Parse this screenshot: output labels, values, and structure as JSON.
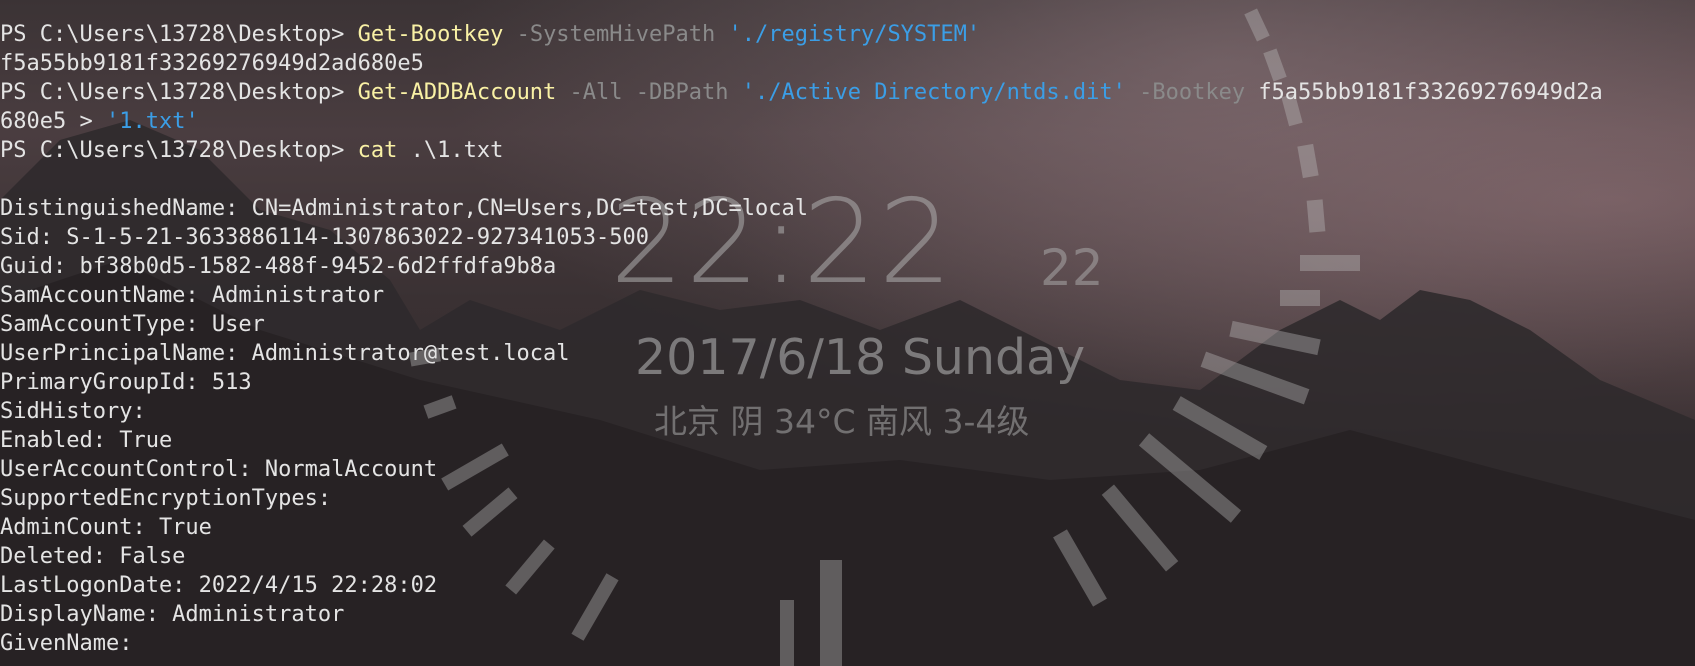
{
  "wallpaper": {
    "clock_time": "22:22",
    "clock_seconds": "22",
    "clock_date": "2017/6/18 Sunday",
    "clock_weather": "北京 阴 34°C 南风 3-4级"
  },
  "colors": {
    "command": "#f9f1a5",
    "parameter": "#8a8a8a",
    "string": "#3b9ee6",
    "text": "#e4e4e4"
  },
  "terminal": {
    "prompt": "PS C:\\Users\\13728\\Desktop> ",
    "cmd1": {
      "command": "Get-Bootkey",
      "param": " -SystemHivePath ",
      "arg": "'./registry/SYSTEM'"
    },
    "output1": "f5a55bb9181f33269276949d2ad680e5",
    "cmd2": {
      "command": "Get-ADDBAccount",
      "param1": " -All -DBPath ",
      "arg1": "'./Active Directory/ntds.dit'",
      "param2": " -Bootkey ",
      "arg2": "f5a55bb9181f33269276949d2a",
      "wrap": "680e5 > ",
      "arg3": "'1.txt'"
    },
    "cmd3": {
      "command": "cat",
      "arg": " .\\1.txt"
    },
    "output_lines": [
      "DistinguishedName: CN=Administrator,CN=Users,DC=test,DC=local",
      "Sid: S-1-5-21-3633886114-1307863022-927341053-500",
      "Guid: bf38b0d5-1582-488f-9452-6d2ffdfa9b8a",
      "SamAccountName: Administrator",
      "SamAccountType: User",
      "UserPrincipalName: Administrator@test.local",
      "PrimaryGroupId: 513",
      "SidHistory:",
      "Enabled: True",
      "UserAccountControl: NormalAccount",
      "SupportedEncryptionTypes:",
      "AdminCount: True",
      "Deleted: False",
      "LastLogonDate: 2022/4/15 22:28:02",
      "DisplayName: Administrator",
      "GivenName:"
    ]
  }
}
